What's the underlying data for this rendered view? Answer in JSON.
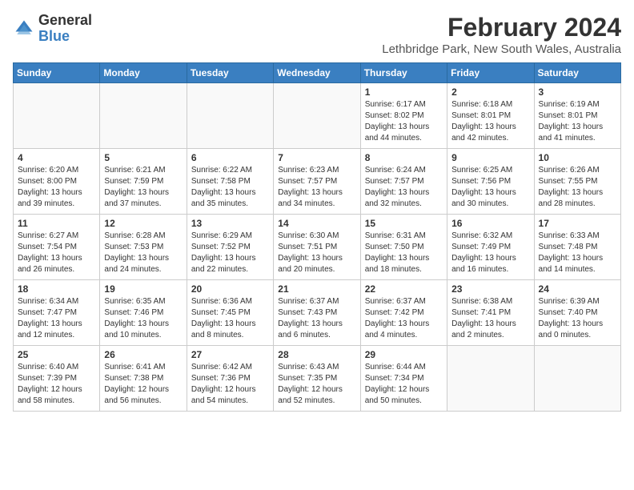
{
  "header": {
    "logo_general": "General",
    "logo_blue": "Blue",
    "title": "February 2024",
    "subtitle": "Lethbridge Park, New South Wales, Australia"
  },
  "weekdays": [
    "Sunday",
    "Monday",
    "Tuesday",
    "Wednesday",
    "Thursday",
    "Friday",
    "Saturday"
  ],
  "weeks": [
    [
      {
        "day": "",
        "info": ""
      },
      {
        "day": "",
        "info": ""
      },
      {
        "day": "",
        "info": ""
      },
      {
        "day": "",
        "info": ""
      },
      {
        "day": "1",
        "info": "Sunrise: 6:17 AM\nSunset: 8:02 PM\nDaylight: 13 hours\nand 44 minutes."
      },
      {
        "day": "2",
        "info": "Sunrise: 6:18 AM\nSunset: 8:01 PM\nDaylight: 13 hours\nand 42 minutes."
      },
      {
        "day": "3",
        "info": "Sunrise: 6:19 AM\nSunset: 8:01 PM\nDaylight: 13 hours\nand 41 minutes."
      }
    ],
    [
      {
        "day": "4",
        "info": "Sunrise: 6:20 AM\nSunset: 8:00 PM\nDaylight: 13 hours\nand 39 minutes."
      },
      {
        "day": "5",
        "info": "Sunrise: 6:21 AM\nSunset: 7:59 PM\nDaylight: 13 hours\nand 37 minutes."
      },
      {
        "day": "6",
        "info": "Sunrise: 6:22 AM\nSunset: 7:58 PM\nDaylight: 13 hours\nand 35 minutes."
      },
      {
        "day": "7",
        "info": "Sunrise: 6:23 AM\nSunset: 7:57 PM\nDaylight: 13 hours\nand 34 minutes."
      },
      {
        "day": "8",
        "info": "Sunrise: 6:24 AM\nSunset: 7:57 PM\nDaylight: 13 hours\nand 32 minutes."
      },
      {
        "day": "9",
        "info": "Sunrise: 6:25 AM\nSunset: 7:56 PM\nDaylight: 13 hours\nand 30 minutes."
      },
      {
        "day": "10",
        "info": "Sunrise: 6:26 AM\nSunset: 7:55 PM\nDaylight: 13 hours\nand 28 minutes."
      }
    ],
    [
      {
        "day": "11",
        "info": "Sunrise: 6:27 AM\nSunset: 7:54 PM\nDaylight: 13 hours\nand 26 minutes."
      },
      {
        "day": "12",
        "info": "Sunrise: 6:28 AM\nSunset: 7:53 PM\nDaylight: 13 hours\nand 24 minutes."
      },
      {
        "day": "13",
        "info": "Sunrise: 6:29 AM\nSunset: 7:52 PM\nDaylight: 13 hours\nand 22 minutes."
      },
      {
        "day": "14",
        "info": "Sunrise: 6:30 AM\nSunset: 7:51 PM\nDaylight: 13 hours\nand 20 minutes."
      },
      {
        "day": "15",
        "info": "Sunrise: 6:31 AM\nSunset: 7:50 PM\nDaylight: 13 hours\nand 18 minutes."
      },
      {
        "day": "16",
        "info": "Sunrise: 6:32 AM\nSunset: 7:49 PM\nDaylight: 13 hours\nand 16 minutes."
      },
      {
        "day": "17",
        "info": "Sunrise: 6:33 AM\nSunset: 7:48 PM\nDaylight: 13 hours\nand 14 minutes."
      }
    ],
    [
      {
        "day": "18",
        "info": "Sunrise: 6:34 AM\nSunset: 7:47 PM\nDaylight: 13 hours\nand 12 minutes."
      },
      {
        "day": "19",
        "info": "Sunrise: 6:35 AM\nSunset: 7:46 PM\nDaylight: 13 hours\nand 10 minutes."
      },
      {
        "day": "20",
        "info": "Sunrise: 6:36 AM\nSunset: 7:45 PM\nDaylight: 13 hours\nand 8 minutes."
      },
      {
        "day": "21",
        "info": "Sunrise: 6:37 AM\nSunset: 7:43 PM\nDaylight: 13 hours\nand 6 minutes."
      },
      {
        "day": "22",
        "info": "Sunrise: 6:37 AM\nSunset: 7:42 PM\nDaylight: 13 hours\nand 4 minutes."
      },
      {
        "day": "23",
        "info": "Sunrise: 6:38 AM\nSunset: 7:41 PM\nDaylight: 13 hours\nand 2 minutes."
      },
      {
        "day": "24",
        "info": "Sunrise: 6:39 AM\nSunset: 7:40 PM\nDaylight: 13 hours\nand 0 minutes."
      }
    ],
    [
      {
        "day": "25",
        "info": "Sunrise: 6:40 AM\nSunset: 7:39 PM\nDaylight: 12 hours\nand 58 minutes."
      },
      {
        "day": "26",
        "info": "Sunrise: 6:41 AM\nSunset: 7:38 PM\nDaylight: 12 hours\nand 56 minutes."
      },
      {
        "day": "27",
        "info": "Sunrise: 6:42 AM\nSunset: 7:36 PM\nDaylight: 12 hours\nand 54 minutes."
      },
      {
        "day": "28",
        "info": "Sunrise: 6:43 AM\nSunset: 7:35 PM\nDaylight: 12 hours\nand 52 minutes."
      },
      {
        "day": "29",
        "info": "Sunrise: 6:44 AM\nSunset: 7:34 PM\nDaylight: 12 hours\nand 50 minutes."
      },
      {
        "day": "",
        "info": ""
      },
      {
        "day": "",
        "info": ""
      }
    ]
  ]
}
